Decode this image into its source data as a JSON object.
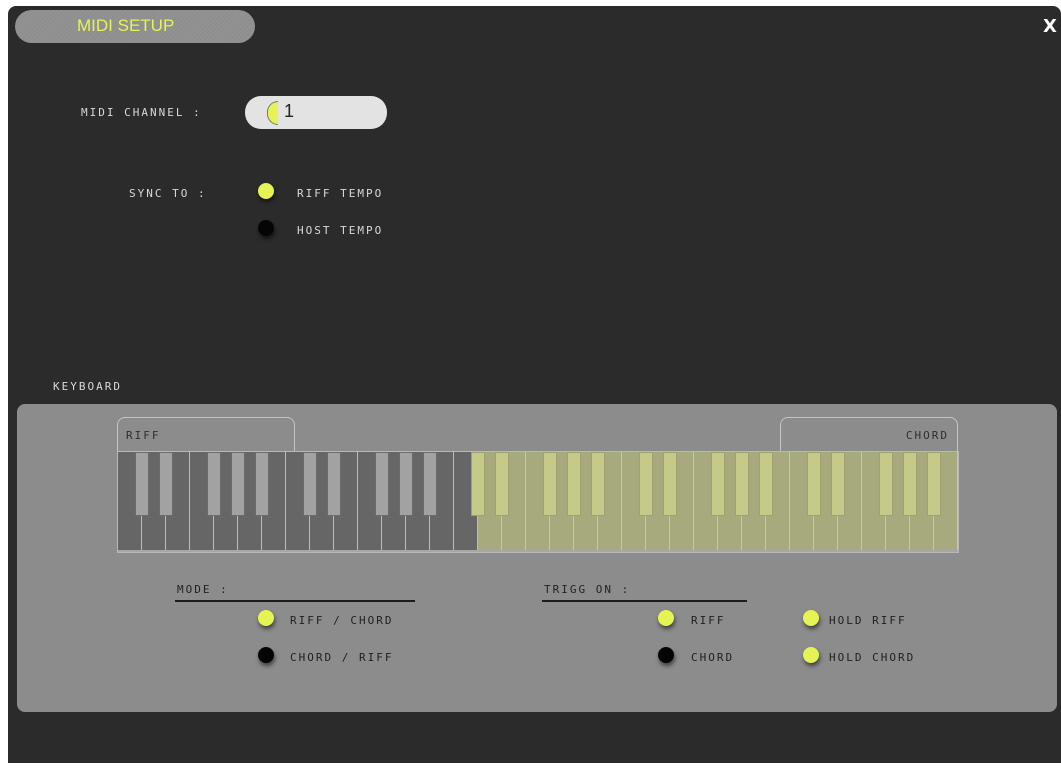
{
  "window": {
    "title": "MIDI SETUP",
    "close_label": "X"
  },
  "midi_channel": {
    "label": "MIDI CHANNEL :",
    "value": "1"
  },
  "sync": {
    "label": "SYNC TO :",
    "options": [
      {
        "label": "RIFF TEMPO",
        "selected": true
      },
      {
        "label": "HOST TEMPO",
        "selected": false
      }
    ]
  },
  "keyboard": {
    "section_label": "KEYBOARD",
    "riff_label": "RIFF",
    "chord_label": "CHORD",
    "white_key_count": 35,
    "riff_white_keys": 15
  },
  "mode": {
    "label": "MODE :",
    "options": [
      {
        "label": "RIFF / CHORD",
        "selected": true
      },
      {
        "label": "CHORD / RIFF",
        "selected": false
      }
    ]
  },
  "trigg_on": {
    "label": "TRIGG ON :",
    "options": [
      {
        "label": "RIFF",
        "selected": true
      },
      {
        "label": "CHORD",
        "selected": false
      }
    ],
    "hold_options": [
      {
        "label": "HOLD RIFF",
        "selected": true
      },
      {
        "label": "HOLD CHORD",
        "selected": true
      }
    ]
  },
  "colors": {
    "accent": "#e6f354",
    "window_bg": "#2b2b2b",
    "panel_bg": "#8c8c8c"
  }
}
